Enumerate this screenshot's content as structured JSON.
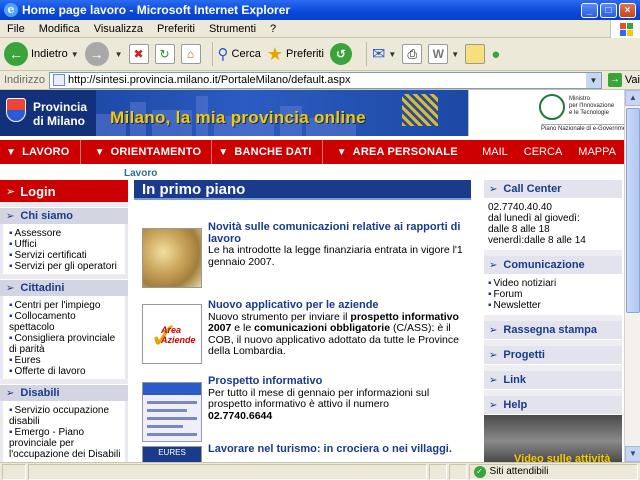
{
  "window": {
    "title": "Home page lavoro - Microsoft Internet Explorer",
    "minimize": "_",
    "maximize": "□",
    "close": "×"
  },
  "menu": [
    "File",
    "Modifica",
    "Visualizza",
    "Preferiti",
    "Strumenti",
    "?"
  ],
  "toolbar": {
    "back": "Indietro",
    "search": "Cerca",
    "favorites": "Preferiti"
  },
  "address": {
    "label": "Indirizzo",
    "url": "http://sintesi.provincia.milano.it/PortaleMilano/default.aspx",
    "go": "Vai"
  },
  "banner": {
    "logo_line1": "Provincia",
    "logo_line2": "di Milano",
    "slogan": "Milano, la mia provincia online",
    "ministry_line1": "Ministro",
    "ministry_line2": "per l'Innovazione",
    "ministry_line3": "e le Tecnologie",
    "ministry_footer": "Piano Nazionale di e-Government"
  },
  "nav": {
    "items": [
      "LAVORO",
      "ORIENTAMENTO",
      "BANCHE DATI",
      "AREA PERSONALE"
    ],
    "right": [
      "MAIL",
      "CERCA",
      "MAPPA"
    ]
  },
  "breadcrumb": "Lavoro",
  "left": {
    "login": "Login",
    "sections": [
      {
        "title": "Chi siamo",
        "items": [
          "Assessore",
          "Uffici",
          "Servizi certificati",
          "Servizi per gli operatori"
        ]
      },
      {
        "title": "Cittadini",
        "items": [
          "Centri per l'impiego",
          "Collocamento spettacolo",
          "Consigliera provinciale di parità",
          "Eures",
          "Offerte di lavoro"
        ]
      },
      {
        "title": "Disabili",
        "items": [
          "Servizio occupazione disabili",
          "Emergo - Piano provinciale per l'occupazione dei Disabili"
        ]
      }
    ]
  },
  "main": {
    "title": "In primo piano",
    "news": [
      {
        "title": "Novità sulle comunicazioni relative ai rapporti di lavoro",
        "body": "Le ha introdotte la legge finanziaria entrata in vigore l'1 gennaio 2007."
      },
      {
        "title": "Nuovo applicativo per le aziende",
        "body_a": "Nuovo strumento per inviare il ",
        "bold_a": "prospetto informativo 2007",
        "body_b": " e le ",
        "bold_b": "comunicazioni obbligatorie",
        "body_c": " (C/ASS): è il COB, il nuovo applicativo adottato da tutte le Province della Lombardia.",
        "thumb_label_1": "Area",
        "thumb_label_2": "Aziende"
      },
      {
        "title": "Prospetto informativo",
        "body": "Per tutto il mese di gennaio per informazioni sul prospetto informativo è attivo il numero",
        "phone": "02.7740.6644"
      },
      {
        "title": "Lavorare nel turismo: in crociera o nei villaggi.",
        "thumb_label": "EURES"
      }
    ]
  },
  "right": {
    "callcenter": {
      "title": "Call Center",
      "lines": [
        "02.7740.40.40",
        "dal lunedì al giovedì:",
        "dalle 8 alle 18",
        "venerdì:dalle 8 alle 14"
      ]
    },
    "comunicazione": {
      "title": "Comunicazione",
      "items": [
        "Video notiziari",
        "Forum",
        "Newsletter"
      ]
    },
    "links": [
      "Rassegna stampa",
      "Progetti",
      "Link",
      "Help"
    ],
    "video_caption": "Video sulle attività"
  },
  "status": {
    "zone": "Siti attendibili"
  }
}
